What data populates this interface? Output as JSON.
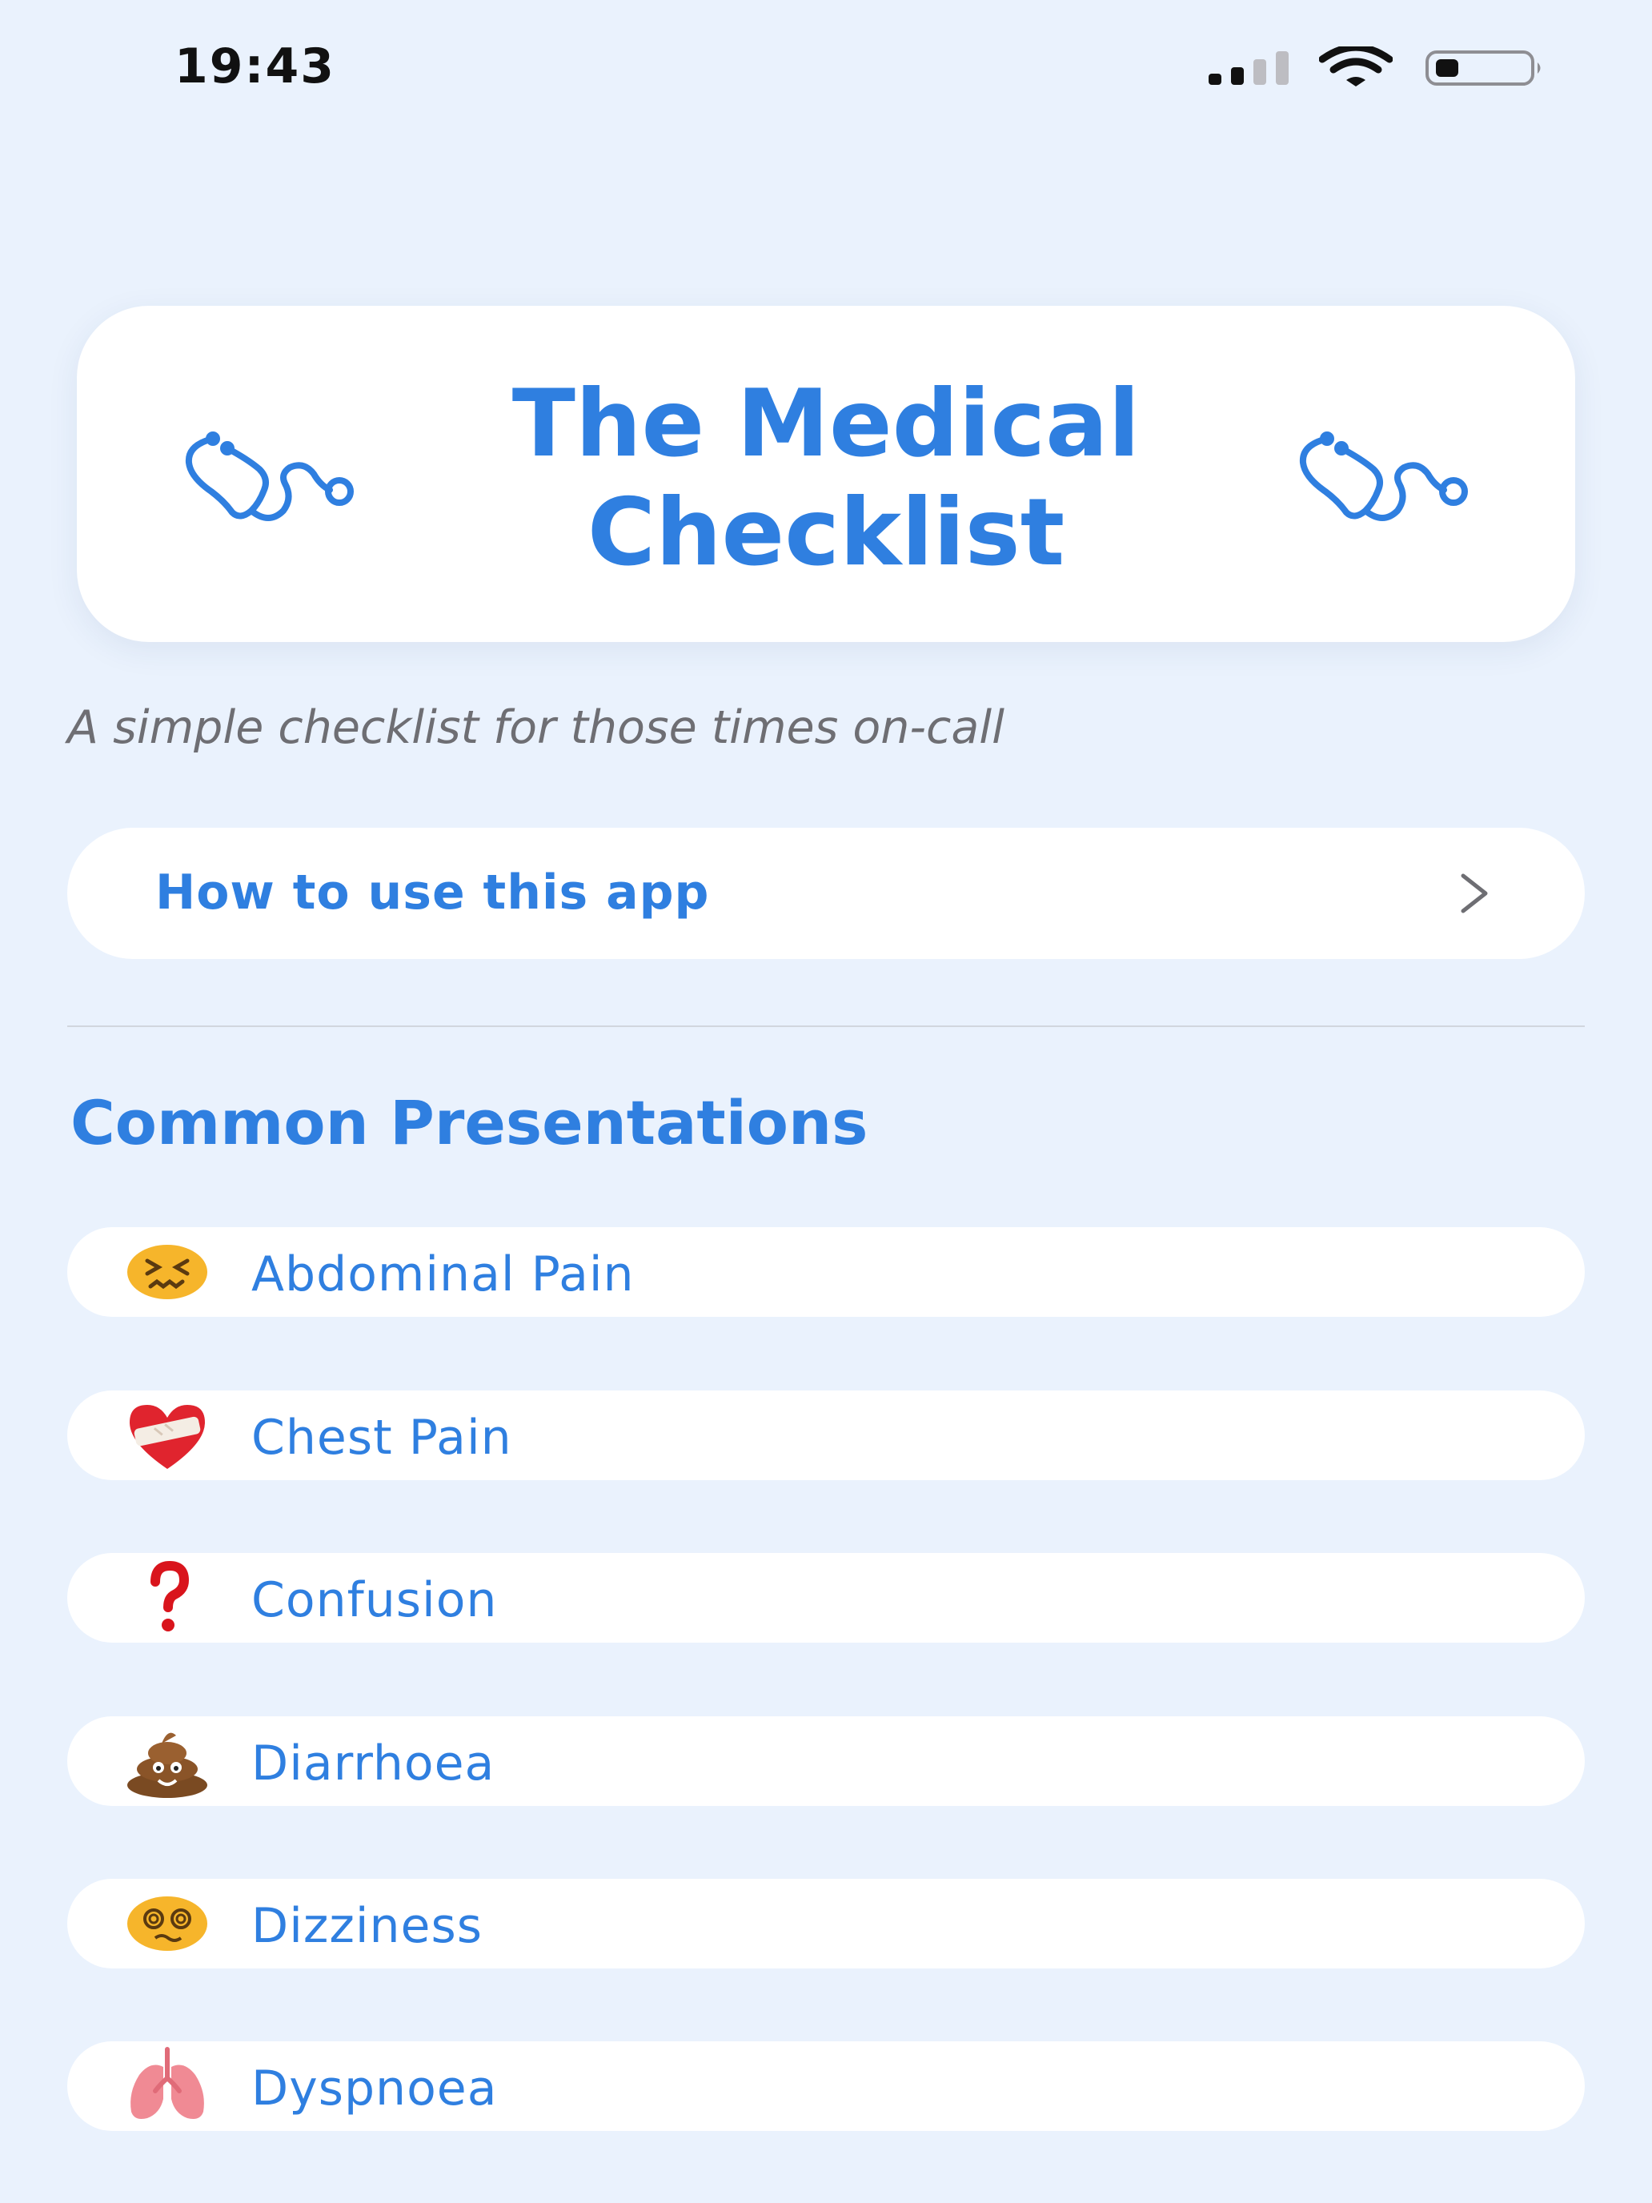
{
  "status_bar": {
    "time": "19:43",
    "signal_icon": "cellular-signal-icon",
    "wifi_icon": "wifi-icon",
    "battery_icon": "battery-icon"
  },
  "header": {
    "title": "The Medical Checklist",
    "icon": "stethoscope-icon"
  },
  "subtitle": "A simple checklist for those times on-call",
  "how_to": {
    "label": "How to use this app",
    "icon": "chevron-right-icon"
  },
  "section": {
    "title": "Common Presentations",
    "items": [
      {
        "label": "Abdominal Pain",
        "icon": "confounded-face-icon"
      },
      {
        "label": "Chest Pain",
        "icon": "mending-heart-icon"
      },
      {
        "label": "Confusion",
        "icon": "question-mark-icon"
      },
      {
        "label": "Diarrhoea",
        "icon": "pile-of-poo-icon"
      },
      {
        "label": "Dizziness",
        "icon": "dizzy-face-icon"
      },
      {
        "label": "Dyspnoea",
        "icon": "lungs-icon"
      }
    ]
  },
  "colors": {
    "background": "#EAF2FD",
    "accent": "#2F7FE0",
    "card": "#FFFFFF",
    "subtitle": "#6E6E73"
  }
}
